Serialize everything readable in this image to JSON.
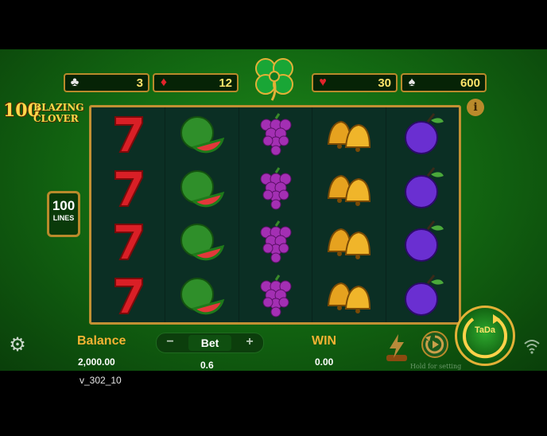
{
  "counters": [
    {
      "suit": "♣",
      "value": "3",
      "color": "black"
    },
    {
      "suit": "♦",
      "value": "12",
      "color": "red"
    },
    {
      "suit": "♥",
      "value": "30",
      "color": "red"
    },
    {
      "suit": "♠",
      "value": "600",
      "color": "black"
    }
  ],
  "logo": {
    "number": "100",
    "word1": "BLAZING",
    "word2": "CLOVER"
  },
  "info_label": "i",
  "lines": {
    "number": "100",
    "label": "LINES"
  },
  "reels": {
    "columns": [
      "seven",
      "watermelon",
      "grapes",
      "bells",
      "plum"
    ],
    "rows": 4
  },
  "footer": {
    "balance_label": "Balance",
    "balance_value": "2,000.00",
    "bet_minus": "−",
    "bet_label": "Bet",
    "bet_plus": "+",
    "bet_value": "0.6",
    "win_label": "WIN",
    "win_value": "0.00",
    "hold_text": "Hold for setting",
    "spin_label": "TaDa"
  },
  "icons": {
    "settings": "gear-icon",
    "turbo": "lightning-icon",
    "auto": "auto-spin-icon",
    "wifi": "wifi-icon"
  },
  "colors": {
    "accent_gold": "#f4b233",
    "frame_gold": "#c29033",
    "reel_bg": "#0b2f24"
  },
  "version": "v_302_10"
}
